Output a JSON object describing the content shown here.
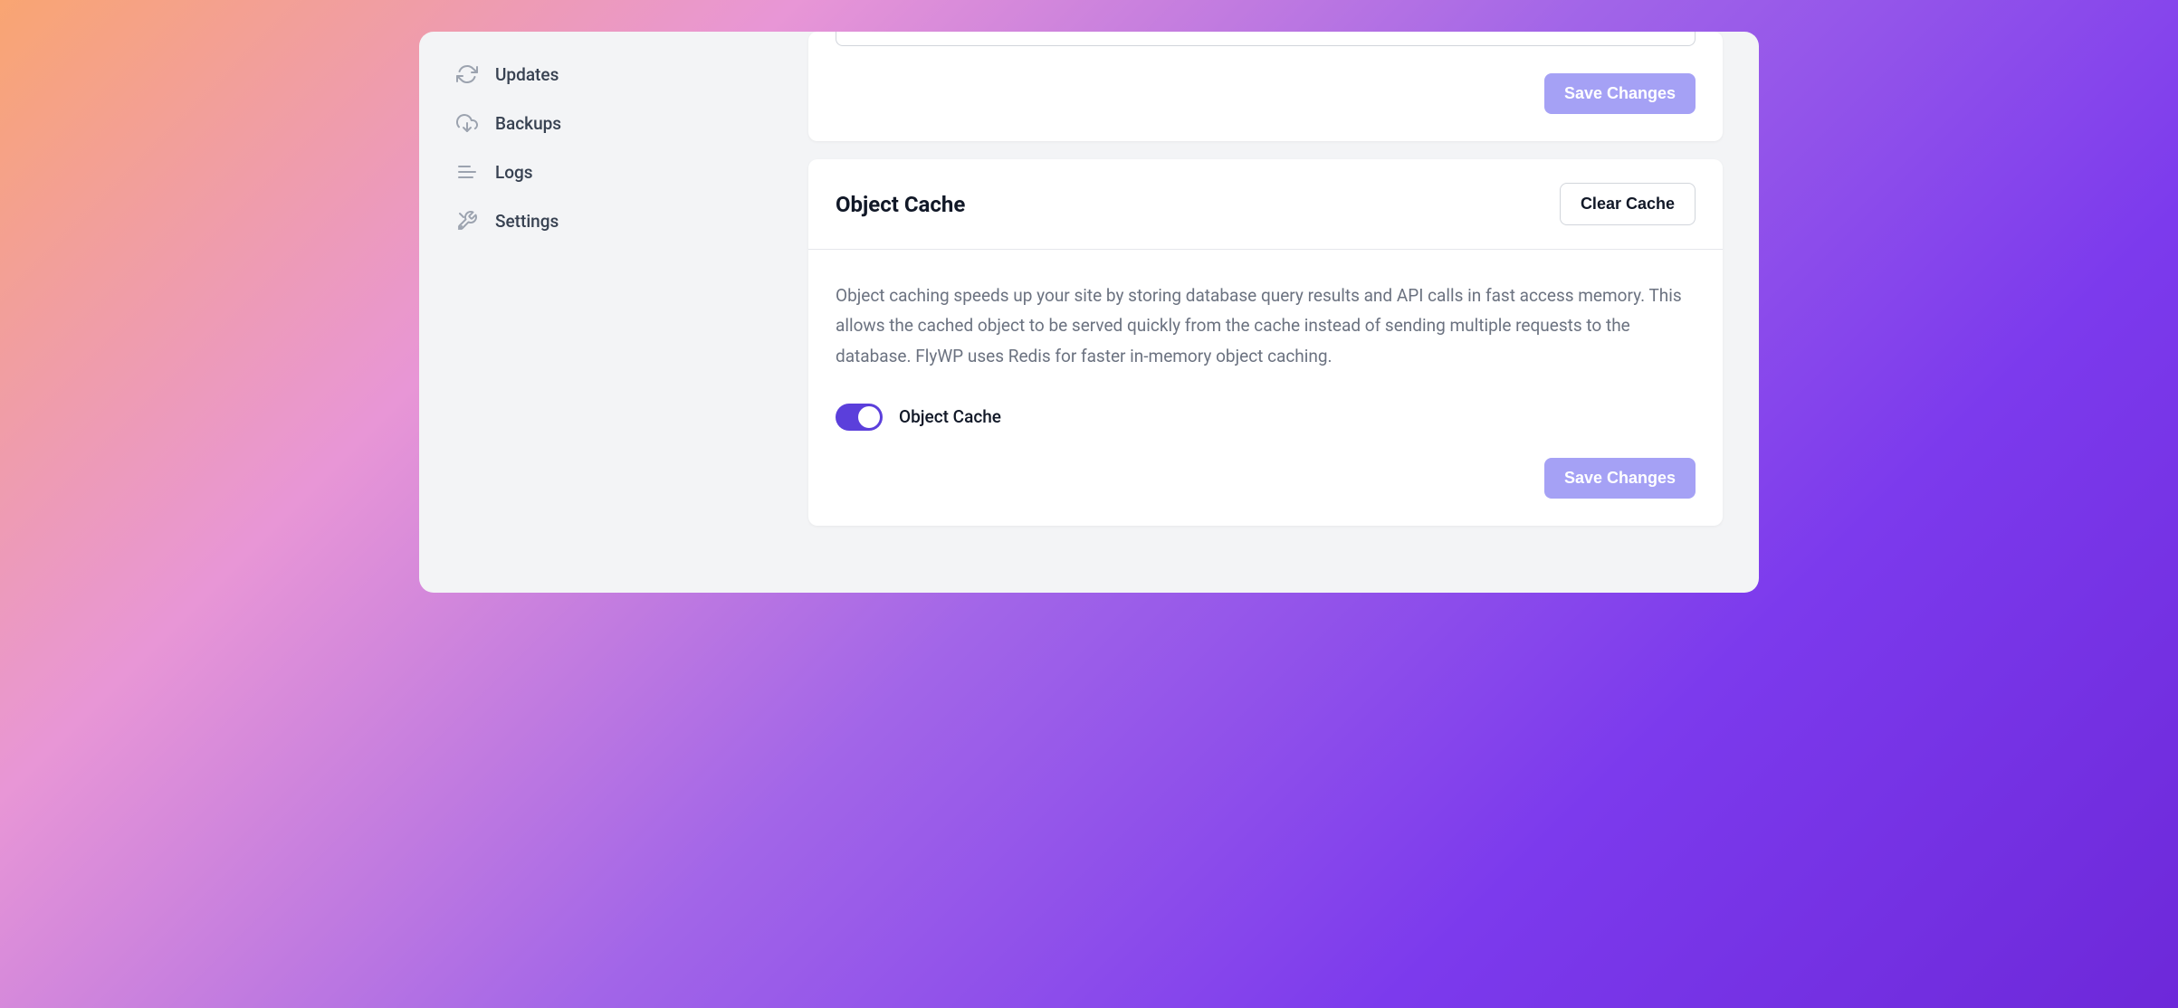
{
  "sidebar": {
    "items": [
      {
        "label": "Updates",
        "icon": "refresh"
      },
      {
        "label": "Backups",
        "icon": "cloud-download"
      },
      {
        "label": "Logs",
        "icon": "list"
      },
      {
        "label": "Settings",
        "icon": "tools"
      }
    ]
  },
  "topCard": {
    "saveButton": "Save Changes"
  },
  "objectCache": {
    "title": "Object Cache",
    "clearButton": "Clear Cache",
    "description": "Object caching speeds up your site by storing database query results and API calls in fast access memory. This allows the cached object to be served quickly from the cache instead of sending multiple requests to the database. FlyWP uses Redis for faster in-memory object caching.",
    "toggleLabel": "Object Cache",
    "toggleEnabled": true,
    "saveButton": "Save Changes"
  }
}
